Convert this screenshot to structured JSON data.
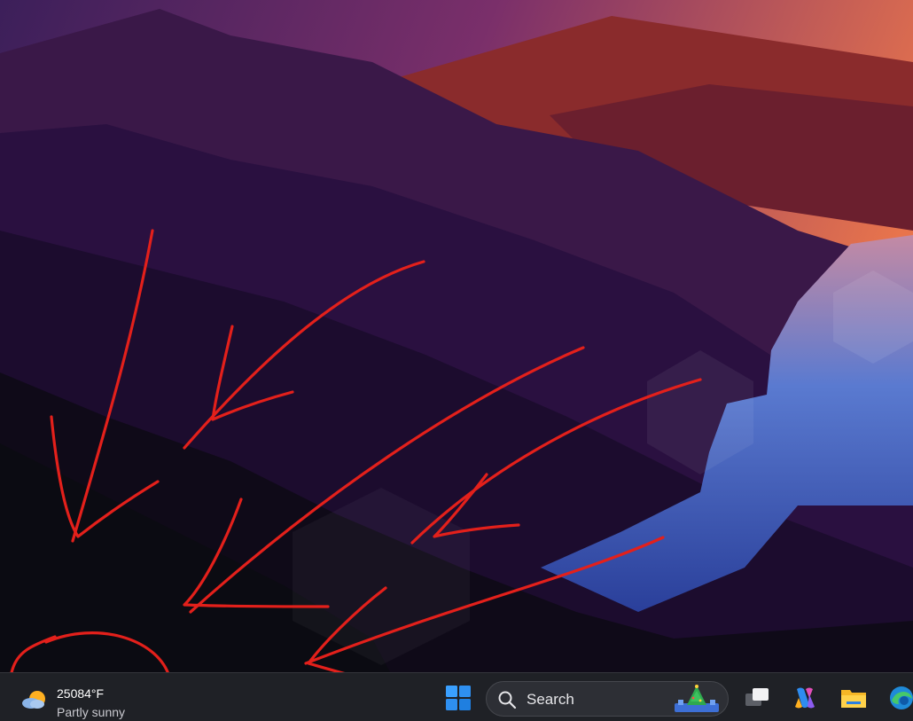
{
  "taskbar": {
    "weather": {
      "temperature": "25084°F",
      "condition": "Partly sunny",
      "icon": "partly-sunny-icon"
    },
    "start_icon": "windows-logo-icon",
    "search": {
      "label": "Search",
      "icon": "search-icon",
      "highlight_icon": "christmas-tree-highlight-icon"
    },
    "apps": [
      {
        "name": "Task View",
        "icon": "task-view-icon"
      },
      {
        "name": "Copilot",
        "icon": "copilot-icon"
      },
      {
        "name": "File Explorer",
        "icon": "file-explorer-icon"
      },
      {
        "name": "Microsoft Edge",
        "icon": "edge-icon"
      }
    ]
  },
  "annotation_color": "#e3201b",
  "colors": {
    "taskbar_bg": "#1f2126",
    "search_bg": "#2d2f35",
    "start_blue": "#3aa0ff"
  }
}
